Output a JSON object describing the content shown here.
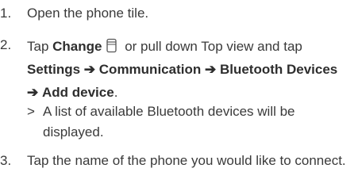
{
  "steps": [
    {
      "number": "1.",
      "text": "Open the phone tile."
    },
    {
      "number": "2.",
      "tap": "Tap ",
      "change": "Change",
      "or_pull": " or pull down Top view and tap ",
      "settings": "Settings",
      "arrow": "➔",
      "communication": "Communication",
      "bluetooth_devices": "Bluetooth Devices",
      "add_device": "Add device",
      "period": ".",
      "icon": "change-icon",
      "result_marker": ">",
      "result": "A list of available Bluetooth devices will be displayed."
    },
    {
      "number": "3.",
      "text": "Tap the name of the phone you would like to connect."
    }
  ]
}
